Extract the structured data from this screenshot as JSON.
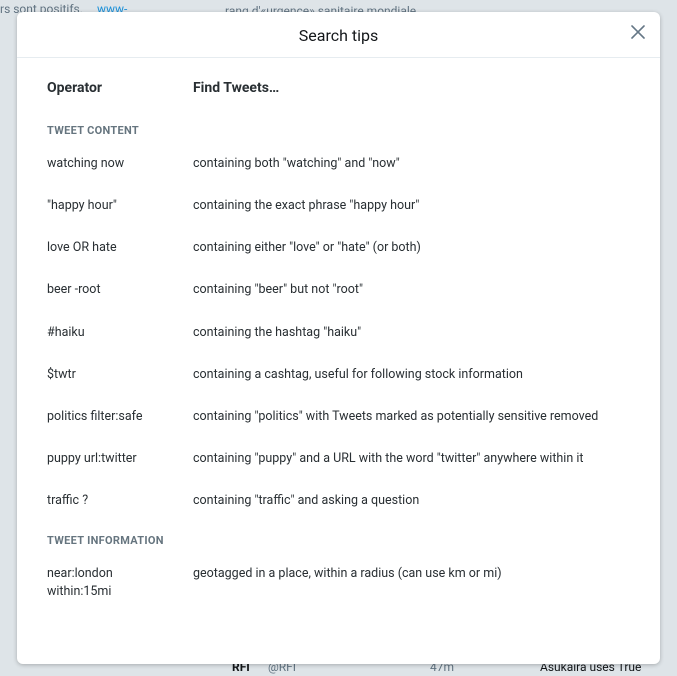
{
  "modal": {
    "title": "Search tips",
    "close_icon": "close"
  },
  "headers": {
    "operator": "Operator",
    "find": "Find Tweets…"
  },
  "sections": [
    {
      "label": "TWEET CONTENT",
      "rows": [
        {
          "op": "watching now",
          "desc": "containing both \"watching\" and \"now\""
        },
        {
          "op": "\"happy hour\"",
          "desc": "containing the exact phrase \"happy hour\""
        },
        {
          "op": "love OR hate",
          "desc": "containing either \"love\" or \"hate\" (or both)"
        },
        {
          "op": "beer -root",
          "desc": "containing \"beer\" but not \"root\""
        },
        {
          "op": "#haiku",
          "desc": "containing the hashtag \"haiku\""
        },
        {
          "op": "$twtr",
          "desc": "containing a cashtag, useful for following stock information"
        },
        {
          "op": "politics filter:safe",
          "desc": "containing \"politics\" with Tweets marked as potentially sensitive removed"
        },
        {
          "op": "puppy url:twitter",
          "desc": "containing \"puppy\" and a URL with the word \"twitter\" anywhere within it"
        },
        {
          "op": "traffic ?",
          "desc": "containing \"traffic\" and asking a question"
        }
      ]
    },
    {
      "label": "TWEET INFORMATION",
      "rows": [
        {
          "op": "near:london\nwithin:15mi",
          "desc": "geotagged in a place, within a radius (can use km or mi)"
        }
      ]
    }
  ],
  "background": {
    "frag1": "rs sont positifs.",
    "frag1b": "www-",
    "frag2": "rang d'«urgence» sanitaire mondiale.",
    "frag3": "RFI",
    "frag4": "@RFI",
    "frag5": "47m",
    "frag6": "Asukaira uses True"
  }
}
